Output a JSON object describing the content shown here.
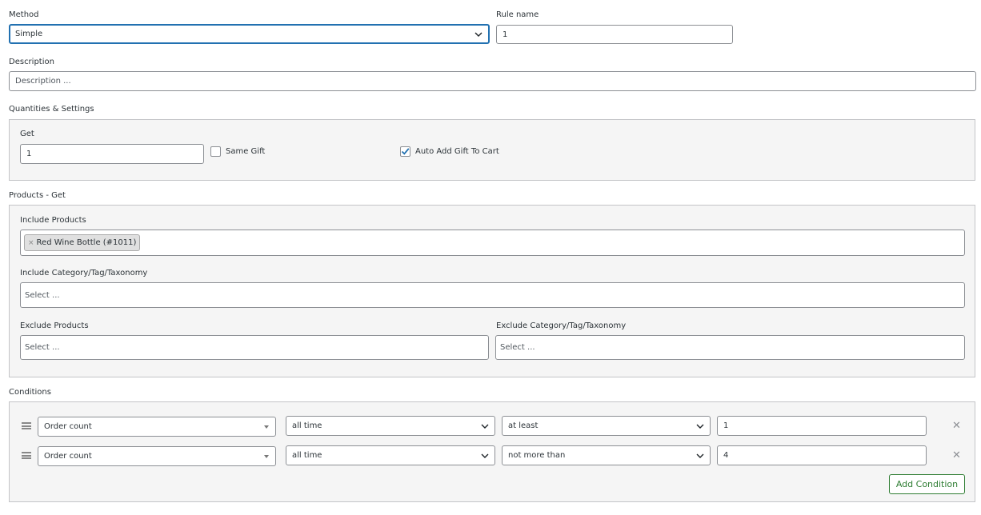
{
  "method": {
    "label": "Method",
    "value": "Simple"
  },
  "rule_name": {
    "label": "Rule name",
    "value": "1"
  },
  "description": {
    "label": "Description",
    "placeholder": "Description ..."
  },
  "quantities": {
    "title": "Quantities & Settings",
    "get_label": "Get",
    "get_value": "1",
    "same_gift": {
      "label": "Same Gift",
      "checked": false
    },
    "auto_add": {
      "label": "Auto Add Gift To Cart",
      "checked": true
    }
  },
  "products_get": {
    "title": "Products - Get",
    "include_products": {
      "label": "Include Products",
      "tags": [
        "Red Wine Bottle (#1011)"
      ],
      "remove_glyph": "×"
    },
    "include_category": {
      "label": "Include Category/Tag/Taxonomy",
      "placeholder": "Select ..."
    },
    "exclude_products": {
      "label": "Exclude Products",
      "placeholder": "Select ..."
    },
    "exclude_category": {
      "label": "Exclude Category/Tag/Taxonomy",
      "placeholder": "Select ..."
    }
  },
  "conditions": {
    "title": "Conditions",
    "rows": [
      {
        "type": "Order count",
        "period": "all time",
        "operator": "at least",
        "value": "1"
      },
      {
        "type": "Order count",
        "period": "all time",
        "operator": "not more than",
        "value": "4"
      }
    ],
    "remove_glyph": "✕",
    "add_button": "Add Condition"
  },
  "icons": {
    "select_arrow": "chevron-down-icon",
    "dropdown_triangle": "caret-down-icon",
    "drag": "drag-handle-icon",
    "remove": "close-icon",
    "check": "checkmark-icon"
  },
  "colors": {
    "focus": "#2271b1",
    "checkbox": "#2271b1",
    "add_button": "#2e7d32",
    "panel_bg": "#f5f5f5"
  }
}
